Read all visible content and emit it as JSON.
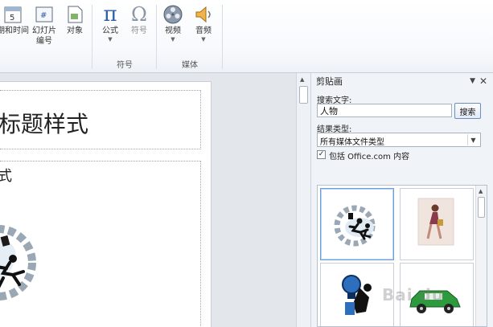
{
  "ribbon": {
    "items": [
      {
        "label_line1": "期和时间",
        "label_line2": ""
      },
      {
        "label_line1": "幻灯片",
        "label_line2": "编号"
      },
      {
        "label_line1": "对象",
        "label_line2": ""
      },
      {
        "label_line1": "公式",
        "label_line2": ""
      },
      {
        "label_line1": "符号",
        "label_line2": ""
      },
      {
        "label_line1": "视频",
        "label_line2": ""
      },
      {
        "label_line1": "音频",
        "label_line2": ""
      }
    ],
    "groups": {
      "symbols": "符号",
      "media": "媒体"
    }
  },
  "slide": {
    "title": "标题样式",
    "body": "式"
  },
  "clipart_pane": {
    "title": "剪贴画",
    "search_label": "搜索文字:",
    "search_value": "人物",
    "search_button": "搜索",
    "result_type_label": "结果类型:",
    "result_type_value": "所有媒体文件类型",
    "include_checked": true,
    "include_label": "包括 Office.com 内容"
  },
  "watermark": "Bai du"
}
